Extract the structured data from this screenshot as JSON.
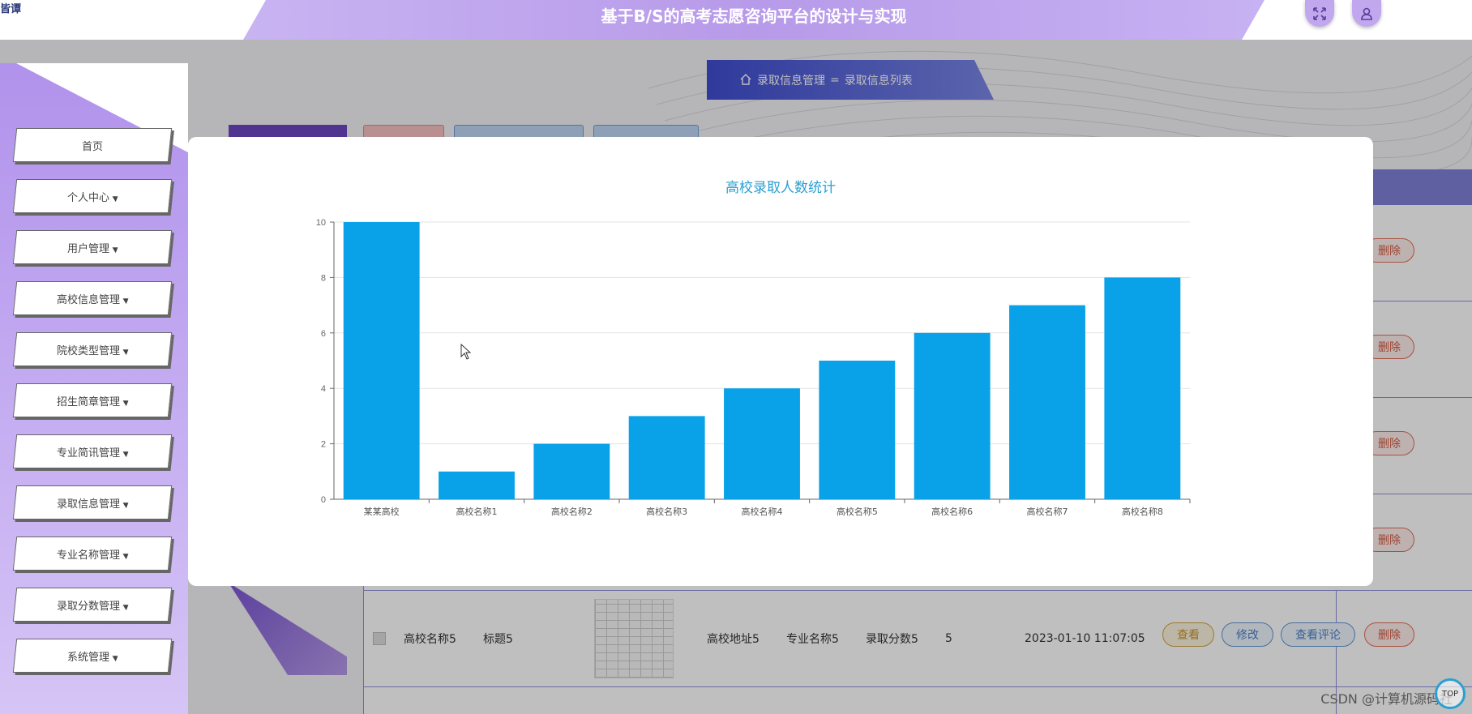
{
  "app": {
    "logo_fragment": "皆谭",
    "title": "基于B/S的高考志愿咨询平台的设计与实现"
  },
  "header": {
    "fullscreen_icon": "fullscreen-icon",
    "user_icon": "user-icon"
  },
  "breadcrumb": {
    "home_icon": "home-icon",
    "parent": "录取信息管理",
    "separator": "=",
    "current": "录取信息列表"
  },
  "sidebar": {
    "items": [
      {
        "label": "首页",
        "has_caret": false
      },
      {
        "label": "个人中心",
        "has_caret": true
      },
      {
        "label": "用户管理",
        "has_caret": true
      },
      {
        "label": "高校信息管理",
        "has_caret": true
      },
      {
        "label": "院校类型管理",
        "has_caret": true
      },
      {
        "label": "招生简章管理",
        "has_caret": true
      },
      {
        "label": "专业简讯管理",
        "has_caret": true
      },
      {
        "label": "录取信息管理",
        "has_caret": true
      },
      {
        "label": "专业名称管理",
        "has_caret": true
      },
      {
        "label": "录取分数管理",
        "has_caret": true
      },
      {
        "label": "系统管理",
        "has_caret": true
      }
    ]
  },
  "table": {
    "row5": {
      "school": "高校名称5",
      "title": "标题5",
      "address": "高校地址5",
      "major": "专业名称5",
      "score": "录取分数5",
      "count": "5",
      "time": "2023-01-10 11:07:05"
    },
    "actions": {
      "view": "查看",
      "edit": "修改",
      "comment": "查看评论",
      "delete": "删除"
    }
  },
  "colors": {
    "bar": "#09a1e8",
    "title": "#2aa0d2",
    "accent": "#b79ae9"
  },
  "chart_data": {
    "type": "bar",
    "title": "高校录取人数统计",
    "categories": [
      "某某高校",
      "高校名称1",
      "高校名称2",
      "高校名称3",
      "高校名称4",
      "高校名称5",
      "高校名称6",
      "高校名称7",
      "高校名称8"
    ],
    "values": [
      10,
      1,
      2,
      3,
      4,
      5,
      6,
      7,
      8
    ],
    "ylim": [
      0,
      10
    ],
    "yticks": [
      0,
      2,
      4,
      6,
      8,
      10
    ],
    "grid": true
  },
  "footer": {
    "watermark": "CSDN @计算机源码社",
    "scroll_top": "TOP"
  }
}
